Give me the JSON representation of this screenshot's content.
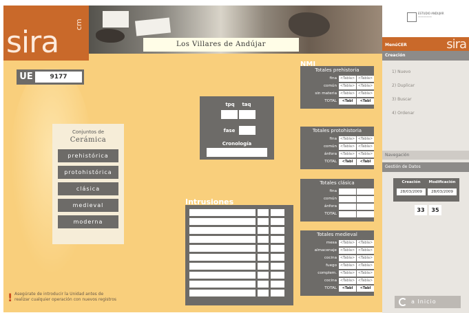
{
  "header": {
    "logo": "sira",
    "logo_sub": "cm",
    "site_title": "Los Villares de Andújar"
  },
  "ue": {
    "label": "UE",
    "value": "9177"
  },
  "ceramica": {
    "title_line1": "Conjuntos de",
    "title_line2": "Cerámica",
    "buttons": [
      "prehistórica",
      "protohistórica",
      "clásica",
      "medieval",
      "moderna"
    ]
  },
  "chrono": {
    "tpq": "tpq",
    "taq": "taq",
    "fase": "fase",
    "cronologia": "Cronología"
  },
  "intrusiones": {
    "title": "Intrusiones"
  },
  "nmi": {
    "title": "NMI",
    "panels": [
      {
        "heading": "Totales prehistoria",
        "rows": [
          {
            "label": "fina",
            "c1": "<Tabla>",
            "c2": "<Tabla>"
          },
          {
            "label": "común",
            "c1": "<Tabla>",
            "c2": "<Tabla>"
          },
          {
            "label": "sin materia",
            "c1": "<Tabla>",
            "c2": "<Tabla>"
          },
          {
            "label": "TOTAL",
            "c1": "<Tabl",
            "c2": "<Tabl",
            "total": true
          }
        ]
      },
      {
        "heading": "Totales protohistoria",
        "rows": [
          {
            "label": "fina",
            "c1": "<Tabla>",
            "c2": "<Tabla>"
          },
          {
            "label": "común",
            "c1": "<Tabla>",
            "c2": "<Tabla>"
          },
          {
            "label": "ánfora",
            "c1": "<Tabla>",
            "c2": "<Tabla>"
          },
          {
            "label": "TOTAL",
            "c1": "<Tabl",
            "c2": "<Tabl",
            "total": true
          }
        ]
      },
      {
        "heading": "Totales clásica",
        "rows": [
          {
            "label": "fina",
            "c1": "",
            "c2": ""
          },
          {
            "label": "común",
            "c1": "",
            "c2": ""
          },
          {
            "label": "ánfora",
            "c1": "",
            "c2": ""
          },
          {
            "label": "TOTAL",
            "c1": "",
            "c2": "",
            "total": true
          }
        ]
      },
      {
        "heading": "Totales medieval",
        "rows": [
          {
            "label": "mesa",
            "c1": "<Tabla>",
            "c2": "<Tabla>"
          },
          {
            "label": "almacenaje",
            "c1": "<Tabla>",
            "c2": "<Tabla>"
          },
          {
            "label": "cocina",
            "c1": "<Tabla>",
            "c2": "<Tabla>"
          },
          {
            "label": "fuego",
            "c1": "<Tabla>",
            "c2": "<Tabla>"
          },
          {
            "label": "complem.",
            "c1": "<Tabla>",
            "c2": "<Tabla>"
          },
          {
            "label": "cocina",
            "c1": "<Tabla>",
            "c2": "<Tabla>"
          },
          {
            "label": "TOTAL",
            "c1": "<Tabl",
            "c2": "<Tabl",
            "total": true
          }
        ]
      }
    ]
  },
  "notice": {
    "line1": "Asegúrate de introducir la Unidad antes de",
    "line2": "realizar cualquier operación con nuevos registros"
  },
  "sidebar": {
    "emblem_text_1": "ESTUDIO ANDUJAR",
    "emblem_text_2": "—————",
    "menu_label": "MenúCER",
    "menu_logo": "sira",
    "creacion": "Creación",
    "items": [
      "1) Nuevo",
      "2) Duplicar",
      "3) Buscar",
      "4) Ordenar"
    ],
    "navegacion": "Navegación",
    "gestion": "Gestión de Datos",
    "creacion_date_label": "Creación",
    "modificacion_date_label": "Modificación",
    "creacion_date": "28/03/2009",
    "modificacion_date": "28/03/2009",
    "counter_1": "33",
    "counter_2": "35",
    "inicio": "a Inicio"
  },
  "colors": {
    "background": "#f9cf7c",
    "accent": "#c9692a",
    "panel": "#6d6b68"
  }
}
